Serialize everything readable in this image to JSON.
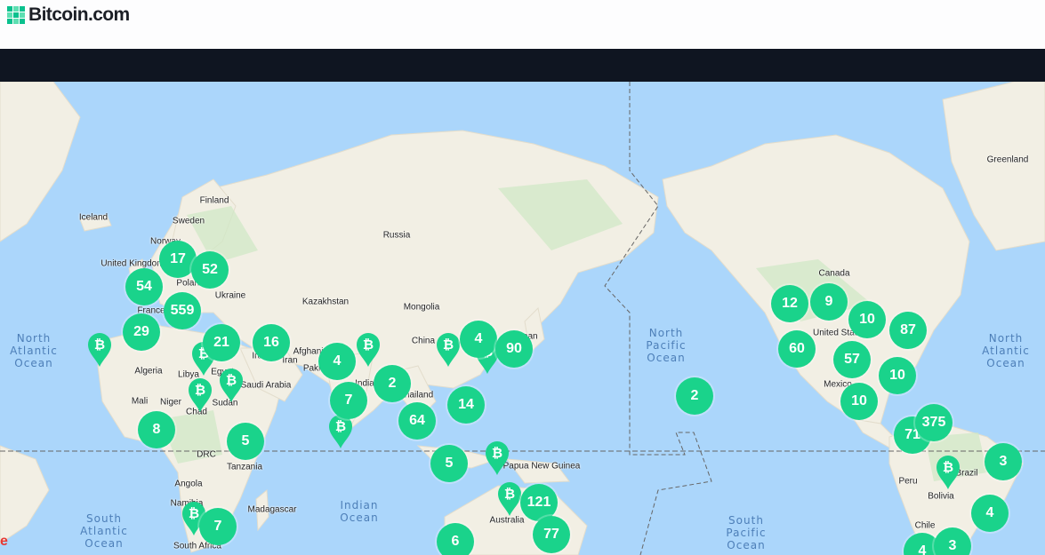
{
  "header": {
    "brand": "Bitcoin.com"
  },
  "colors": {
    "marker": "#1ad38b",
    "water": "#abd6fb",
    "land": "#f2efe9",
    "navbar": "#0f1521"
  },
  "map": {
    "country_labels": [
      "Greenland",
      "Iceland",
      "Finland",
      "Sweden",
      "Norway",
      "United Kingdom",
      "Poland",
      "Ukraine",
      "France",
      "Kazakhstan",
      "Russia",
      "Mongolia",
      "China",
      "Afghanistan",
      "Pakistan",
      "Iran",
      "Iraq",
      "Saudi Arabia",
      "Algeria",
      "Libya",
      "Egypt",
      "Mali",
      "Niger",
      "Chad",
      "Sudan",
      "DRC",
      "Tanzania",
      "Angola",
      "Namibia",
      "Madagascar",
      "South Africa",
      "Thailand",
      "Papua New Guinea",
      "Australia",
      "Canada",
      "United States",
      "Mexico",
      "Peru",
      "Brazil",
      "Bolivia",
      "Chile",
      "India",
      "Japan"
    ],
    "ocean_labels": [
      "North\nAtlantic\nOcean",
      "North\nPacific\nOcean",
      "North\nAtlantic\nOcean",
      "South\nAtlantic\nOcean",
      "Indian\nOcean",
      "South\nPacific\nOcean"
    ],
    "clusters": [
      "17",
      "52",
      "54",
      "559",
      "29",
      "21",
      "16",
      "4",
      "7",
      "2",
      "4",
      "90",
      "64",
      "14",
      "5",
      "8",
      "5",
      "121",
      "77",
      "6",
      "7",
      "2",
      "12",
      "9",
      "10",
      "87",
      "60",
      "57",
      "10",
      "10",
      "71",
      "375",
      "3",
      "4",
      "4",
      "3"
    ],
    "single_pin_icon": "bitcoin-pin-icon"
  },
  "footer": {
    "attribution": "e"
  }
}
